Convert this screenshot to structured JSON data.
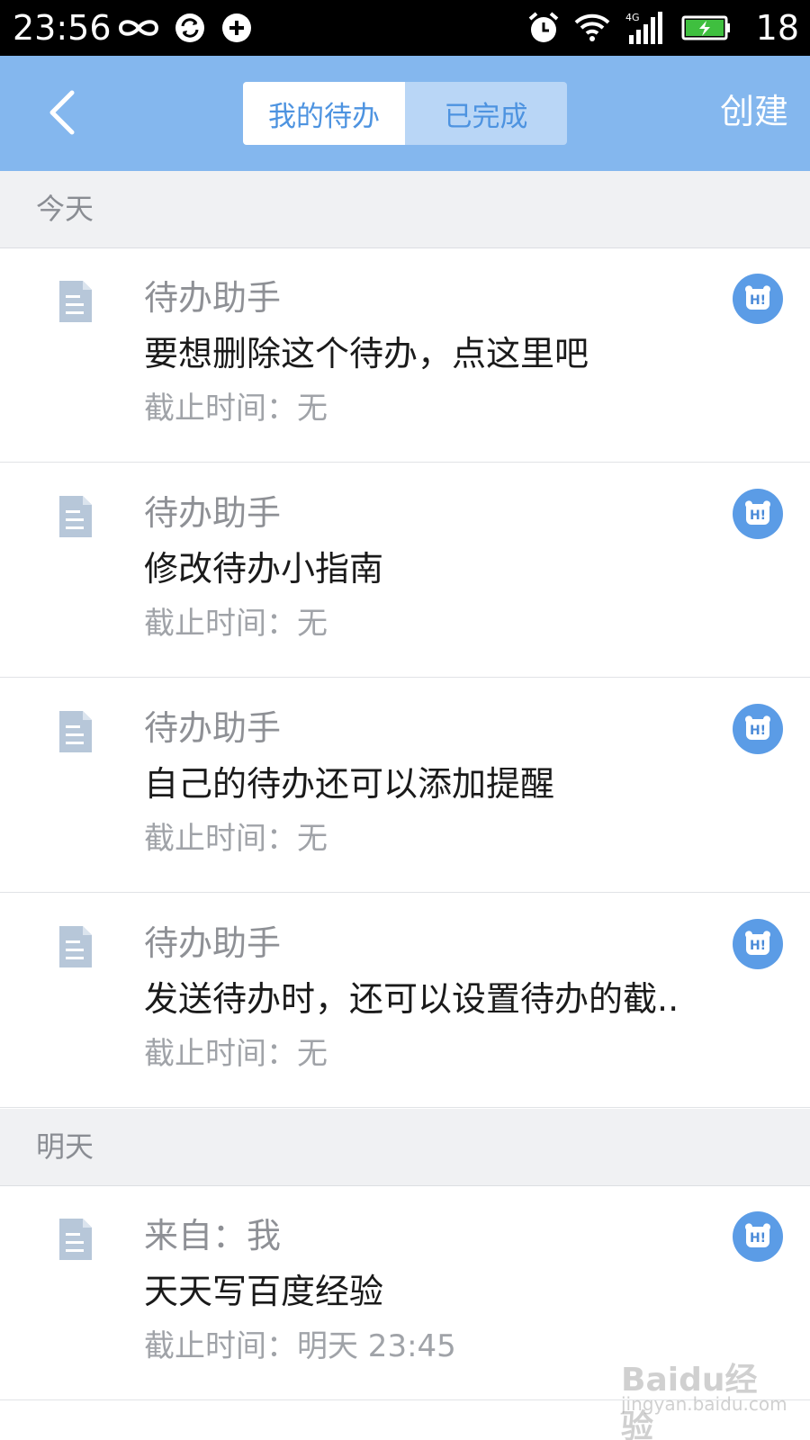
{
  "status_bar": {
    "time": "23:56",
    "battery_level": "18",
    "icons": [
      "infinity-icon",
      "sync-icon",
      "sync-add-icon",
      "alarm-icon",
      "wifi-icon",
      "signal-4g-icon",
      "battery-charging-icon"
    ]
  },
  "header": {
    "tabs": [
      {
        "label": "我的待办",
        "active": true
      },
      {
        "label": "已完成",
        "active": false
      }
    ],
    "create_label": "创建",
    "colors": {
      "bar": "#84b7ee",
      "accent": "#4d93e0"
    }
  },
  "sections": [
    {
      "label": "今天",
      "items": [
        {
          "sender": "待办助手",
          "title": "要想删除这个待办，点这里吧",
          "deadline": "截止时间：无"
        },
        {
          "sender": "待办助手",
          "title": "修改待办小指南",
          "deadline": "截止时间：无"
        },
        {
          "sender": "待办助手",
          "title": "自己的待办还可以添加提醒",
          "deadline": "截止时间：无"
        },
        {
          "sender": "待办助手",
          "title": "发送待办时，还可以设置待办的截..",
          "deadline": "截止时间：无"
        }
      ]
    },
    {
      "label": "明天",
      "items": [
        {
          "sender": "来自：我",
          "title": "天天写百度经验",
          "deadline": "截止时间：明天 23:45"
        }
      ]
    }
  ],
  "badge": {
    "text": "H!"
  },
  "watermark": {
    "brand": "Baidu经验",
    "url": "jingyan.baidu.com"
  }
}
